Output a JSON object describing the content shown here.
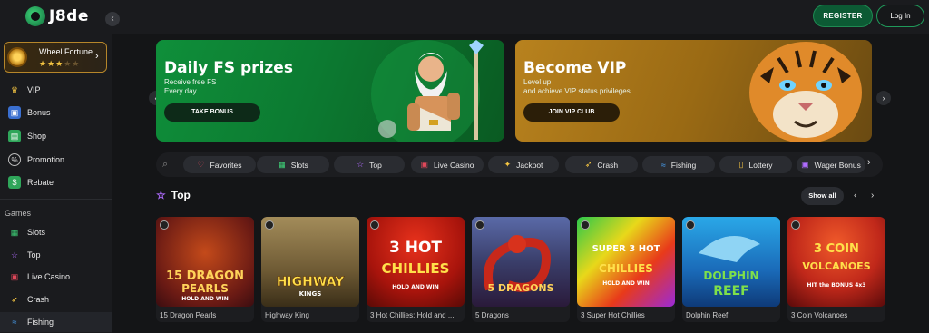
{
  "header": {
    "logo_text": "J8de",
    "register_label": "REGISTER",
    "login_label": "Log In"
  },
  "sidebar": {
    "wheel": {
      "title": "Wheel Fortune",
      "stars_on": 3,
      "stars_total": 5
    },
    "items": [
      {
        "label": "VIP",
        "icon": "crown-icon"
      },
      {
        "label": "Bonus",
        "icon": "gift-icon"
      },
      {
        "label": "Shop",
        "icon": "shop-icon"
      },
      {
        "label": "Promotion",
        "icon": "percent-icon"
      },
      {
        "label": "Rebate",
        "icon": "rebate-icon"
      }
    ],
    "games_heading": "Games",
    "games": [
      {
        "label": "Slots",
        "icon": "slots-icon"
      },
      {
        "label": "Top",
        "icon": "star-icon"
      },
      {
        "label": "Live Casino",
        "icon": "live-casino-icon"
      },
      {
        "label": "Crash",
        "icon": "rocket-icon"
      },
      {
        "label": "Fishing",
        "icon": "fish-icon"
      }
    ]
  },
  "banners": [
    {
      "title": "Daily FS prizes",
      "sub1": "Receive free FS",
      "sub2": "Every day",
      "button": "TAKE BONUS"
    },
    {
      "title": "Become VIP",
      "sub1": "Level up",
      "sub2": "and achieve VIP status privileges",
      "button": "JOIN VIP CLUB"
    }
  ],
  "categories": [
    {
      "label": "Favorites",
      "icon": "heart-icon",
      "color": "#e0485a"
    },
    {
      "label": "Slots",
      "icon": "slots-icon",
      "color": "#3fd67a"
    },
    {
      "label": "Top",
      "icon": "star-icon",
      "color": "#b06cff"
    },
    {
      "label": "Live Casino",
      "icon": "live-casino-icon",
      "color": "#e0485a"
    },
    {
      "label": "Jackpot",
      "icon": "jackpot-icon",
      "color": "#f5c542"
    },
    {
      "label": "Crash",
      "icon": "rocket-icon",
      "color": "#f5c542"
    },
    {
      "label": "Fishing",
      "icon": "fish-icon",
      "color": "#4aa8ff"
    },
    {
      "label": "Lottery",
      "icon": "ticket-icon",
      "color": "#f5c542"
    },
    {
      "label": "Wager Bonus",
      "icon": "wager-icon",
      "color": "#b06cff"
    }
  ],
  "top_section": {
    "title": "Top",
    "show_all": "Show all",
    "games": [
      {
        "name": "15 Dragon Pearls",
        "art_line1": "15 DRAGON",
        "art_line2": "PEARLS",
        "art_line3": "HOLD AND WIN"
      },
      {
        "name": "Highway King",
        "art_line1": "HIGHWAY",
        "art_line2": "KINGS",
        "art_line3": ""
      },
      {
        "name": "3 Hot Chillies: Hold and ...",
        "art_line1": "3 HOT",
        "art_line2": "CHILLIES",
        "art_line3": "HOLD AND WIN"
      },
      {
        "name": "5 Dragons",
        "art_line1": "5 DRAGONS",
        "art_line2": "",
        "art_line3": ""
      },
      {
        "name": "3 Super Hot Chillies",
        "art_line1": "SUPER 3 HOT",
        "art_line2": "CHILLIES",
        "art_line3": "HOLD AND WIN"
      },
      {
        "name": "Dolphin Reef",
        "art_line1": "DOLPHIN",
        "art_line2": "REEF",
        "art_line3": ""
      },
      {
        "name": "3 Coin Volcanoes",
        "art_line1": "3 COIN",
        "art_line2": "VOLCANOES",
        "art_line3": "HIT the BONUS 4x3"
      }
    ]
  },
  "colors": {
    "accent_green": "#1e8a52",
    "star_gold": "#f5c542",
    "top_purple": "#b06cff"
  }
}
